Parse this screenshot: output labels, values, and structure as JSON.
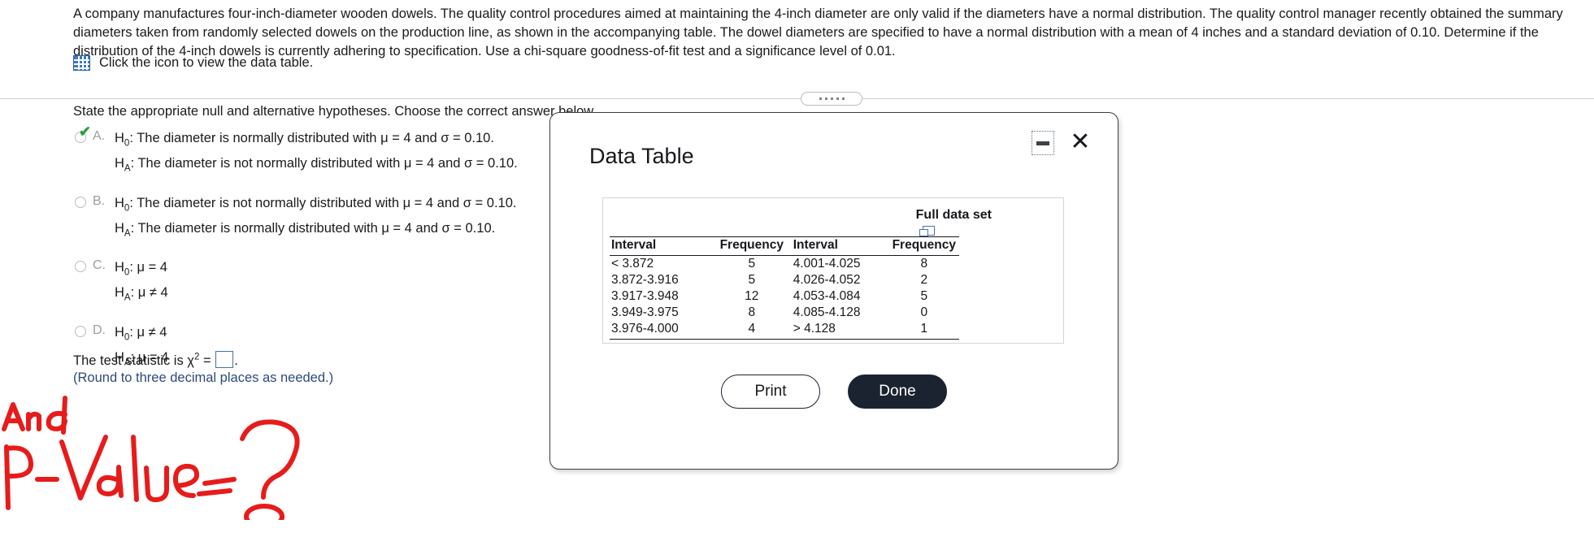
{
  "problem": {
    "text": "A company manufactures four-inch-diameter wooden dowels. The quality control procedures aimed at maintaining the 4-inch diameter are only valid if the diameters have a normal distribution. The quality control manager recently obtained the summary diameters taken from randomly selected dowels on the production line, as shown in the accompanying table. The dowel diameters are specified to have a normal distribution with a mean of 4 inches and a standard deviation of 0.10. Determine if the distribution of the 4-inch dowels is currently adhering to specification. Use a chi-square goodness-of-fit test and a significance level of 0.01.",
    "data_table_link": "Click the icon to view the data table.",
    "grid_icon": "grid-table-icon"
  },
  "question": {
    "prompt": "State the appropriate null and alternative hypotheses. Choose the correct answer below.",
    "choices": [
      {
        "letter": "A.",
        "selected": true,
        "null_label": "H",
        "null_sub": "0",
        "null_text": ": The diameter is normally distributed with μ = 4 and σ = 0.10.",
        "alt_label": "H",
        "alt_sub": "A",
        "alt_text": ": The diameter is not normally distributed with μ = 4 and σ = 0.10."
      },
      {
        "letter": "B.",
        "selected": false,
        "null_label": "H",
        "null_sub": "0",
        "null_text": ": The diameter is not normally distributed with μ = 4 and σ = 0.10.",
        "alt_label": "H",
        "alt_sub": "A",
        "alt_text": ": The diameter is normally distributed with μ = 4 and σ = 0.10."
      },
      {
        "letter": "C.",
        "selected": false,
        "null_label": "H",
        "null_sub": "0",
        "null_text": ": μ = 4",
        "alt_label": "H",
        "alt_sub": "A",
        "alt_text": ": μ ≠ 4"
      },
      {
        "letter": "D.",
        "selected": false,
        "null_label": "H",
        "null_sub": "0",
        "null_text": ": μ ≠ 4",
        "alt_label": "H",
        "alt_sub": "A",
        "alt_text": ": μ = 4"
      }
    ],
    "test_statistic_prefix": "The test statistic is ",
    "test_statistic_symbol": "χ",
    "test_statistic_exp": "2",
    "test_statistic_eq": " = ",
    "test_statistic_value": "",
    "test_statistic_suffix": ".",
    "rounding_hint": "(Round to three decimal places as needed.)"
  },
  "handwriting": {
    "line1": "And",
    "line2": "P-Value = ?",
    "color": "#e81b1b"
  },
  "dialog": {
    "title": "Data Table",
    "minimize_icon": "minimize-icon",
    "close_icon": "close-icon",
    "full_data_set_label": "Full data set",
    "full_data_set_icon": "duplicate-window-icon",
    "table": {
      "headers": [
        "Interval",
        "Frequency",
        "Interval",
        "Frequency"
      ],
      "rows": [
        [
          "< 3.872",
          "5",
          "4.001-4.025",
          "8"
        ],
        [
          "3.872-3.916",
          "5",
          "4.026-4.052",
          "2"
        ],
        [
          "3.917-3.948",
          "12",
          "4.053-4.084",
          "5"
        ],
        [
          "3.949-3.975",
          "8",
          "4.085-4.128",
          "0"
        ],
        [
          "3.976-4.000",
          "4",
          "> 4.128",
          "1"
        ]
      ]
    },
    "buttons": {
      "print": "Print",
      "done": "Done"
    }
  },
  "colors": {
    "accent_blue": "#3c78c8",
    "primary_button": "#1b2330",
    "check_green": "#2e9e3e",
    "hint_blue": "#2e4a7a",
    "handwriting_red": "#e81b1b"
  }
}
